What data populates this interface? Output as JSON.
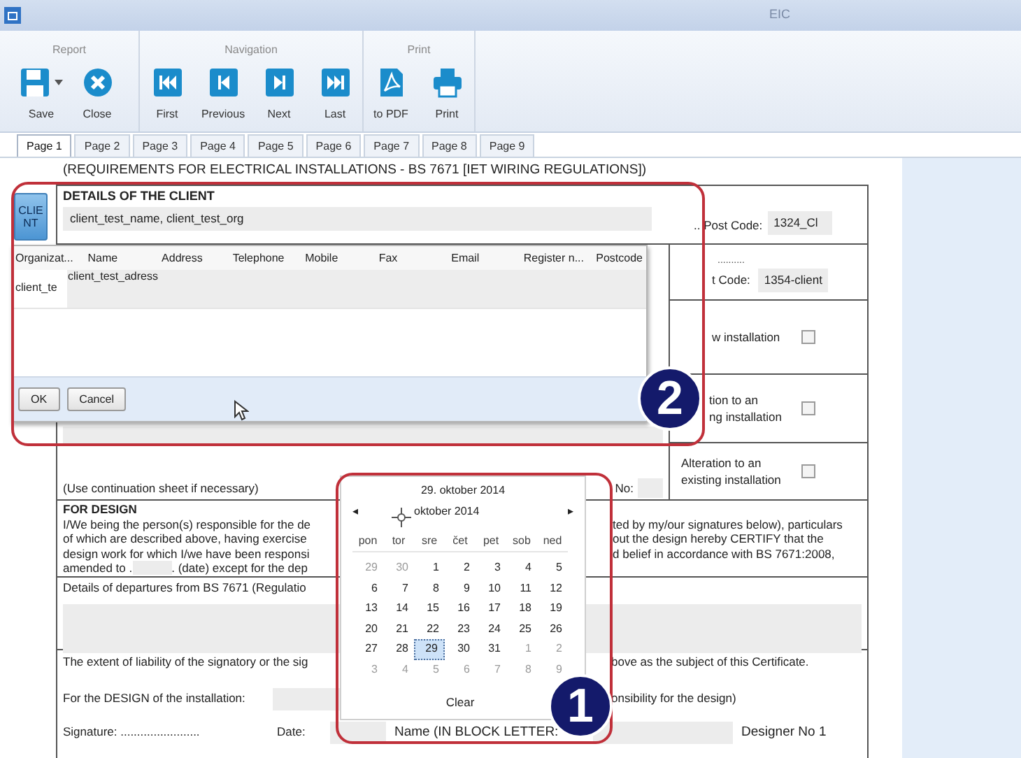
{
  "window": {
    "title": "EIC"
  },
  "ribbon": {
    "groups": [
      {
        "label": "Report",
        "buttons": [
          {
            "label": "Save",
            "kind": "save",
            "dropdown": true
          },
          {
            "label": "Close",
            "kind": "close",
            "dropdown": false
          }
        ]
      },
      {
        "label": "Navigation",
        "buttons": [
          {
            "label": "First",
            "kind": "first",
            "dropdown": false
          },
          {
            "label": "Previous",
            "kind": "previous",
            "dropdown": false
          },
          {
            "label": "Next",
            "kind": "next",
            "dropdown": false
          },
          {
            "label": "Last",
            "kind": "last",
            "dropdown": false
          }
        ]
      },
      {
        "label": "Print",
        "buttons": [
          {
            "label": "to PDF",
            "kind": "pdf",
            "dropdown": false
          },
          {
            "label": "Print",
            "kind": "print",
            "dropdown": false
          }
        ]
      }
    ]
  },
  "tabs": [
    {
      "label": "Page 1",
      "selected": true
    },
    {
      "label": "Page 2",
      "selected": false
    },
    {
      "label": "Page 3",
      "selected": false
    },
    {
      "label": "Page 4",
      "selected": false
    },
    {
      "label": "Page 5",
      "selected": false
    },
    {
      "label": "Page 6",
      "selected": false
    },
    {
      "label": "Page 7",
      "selected": false
    },
    {
      "label": "Page 8",
      "selected": false
    },
    {
      "label": "Page 9",
      "selected": false
    }
  ],
  "document": {
    "heading": "(REQUIREMENTS FOR ELECTRICAL INSTALLATIONS - BS 7671 [IET WIRING REGULATIONS])",
    "client_button": "CLIENT",
    "client_title": "DETAILS OF THE CLIENT",
    "client_value": "client_test_name, client_test_org",
    "post_code_label": ".. Post Code:",
    "post_code_value": "1324_Cl",
    "installation_dots": "..........",
    "installation_post_code_label": "t Code:",
    "installation_post_code_value": "1354-client",
    "options": [
      {
        "lines": [
          "w installation"
        ],
        "checked": false
      },
      {
        "lines": [
          "tion to an",
          "ng installation"
        ],
        "checked": false
      },
      {
        "lines": [
          "Alteration to an",
          "existing installation"
        ],
        "checked": false
      }
    ],
    "continuation_note": "(Use continuation sheet if necessary)",
    "no_label": "No:",
    "design_title": "FOR DESIGN",
    "design_left_lines": [
      "I/We being the person(s) responsible for the de",
      "of which are described above, having exercise",
      "design work for which I/we have been responsi"
    ],
    "amended_prefix": "amended to .",
    "amended_suffix": ". (date) except for the dep",
    "design_right_lines": [
      "ted by my/our signatures below), particulars",
      "out the design hereby CERTIFY that the",
      "d belief in accordance with BS 7671:2008,"
    ],
    "departures_label": "Details of departures from BS 7671 (Regulatio",
    "liability_left": "The extent of liability of the signatory or the sig",
    "liability_right": "bove as the subject of this Certificate.",
    "design_installation_label": "For the DESIGN of the installation:",
    "responsibility_right": "onsibility for the design)",
    "signature_label": "Signature: ........................",
    "date_label": "Date:",
    "name_label": "Name (IN BLOCK LETTER:",
    "designer_label": "Designer No 1"
  },
  "client_dialog": {
    "columns": [
      "Organizat...",
      "Name",
      "Address",
      "Telephone",
      "Mobile",
      "Fax",
      "Email",
      "Register n...",
      "Postcode"
    ],
    "row_first_cell": "client_te",
    "editor_value": "client_test_adress",
    "buttons": [
      "OK",
      "Cancel"
    ]
  },
  "date_picker": {
    "selected_date": "29. oktober 2014",
    "month": "oktober 2014",
    "prev": "◂",
    "next": "▸",
    "weekdays": [
      "pon",
      "tor",
      "sre",
      "čet",
      "pet",
      "sob",
      "ned"
    ],
    "weeks": [
      [
        {
          "day": "29",
          "muted": true,
          "selected": false
        },
        {
          "day": "30",
          "muted": true,
          "selected": false
        },
        {
          "day": "1",
          "muted": false,
          "selected": false
        },
        {
          "day": "2",
          "muted": false,
          "selected": false
        },
        {
          "day": "3",
          "muted": false,
          "selected": false
        },
        {
          "day": "4",
          "muted": false,
          "selected": false
        },
        {
          "day": "5",
          "muted": false,
          "selected": false
        }
      ],
      [
        {
          "day": "6",
          "muted": false,
          "selected": false
        },
        {
          "day": "7",
          "muted": false,
          "selected": false
        },
        {
          "day": "8",
          "muted": false,
          "selected": false
        },
        {
          "day": "9",
          "muted": false,
          "selected": false
        },
        {
          "day": "10",
          "muted": false,
          "selected": false
        },
        {
          "day": "11",
          "muted": false,
          "selected": false
        },
        {
          "day": "12",
          "muted": false,
          "selected": false
        }
      ],
      [
        {
          "day": "13",
          "muted": false,
          "selected": false
        },
        {
          "day": "14",
          "muted": false,
          "selected": false
        },
        {
          "day": "15",
          "muted": false,
          "selected": false
        },
        {
          "day": "16",
          "muted": false,
          "selected": false
        },
        {
          "day": "17",
          "muted": false,
          "selected": false
        },
        {
          "day": "18",
          "muted": false,
          "selected": false
        },
        {
          "day": "19",
          "muted": false,
          "selected": false
        }
      ],
      [
        {
          "day": "20",
          "muted": false,
          "selected": false
        },
        {
          "day": "21",
          "muted": false,
          "selected": false
        },
        {
          "day": "22",
          "muted": false,
          "selected": false
        },
        {
          "day": "23",
          "muted": false,
          "selected": false
        },
        {
          "day": "24",
          "muted": false,
          "selected": false
        },
        {
          "day": "25",
          "muted": false,
          "selected": false
        },
        {
          "day": "26",
          "muted": false,
          "selected": false
        }
      ],
      [
        {
          "day": "27",
          "muted": false,
          "selected": false
        },
        {
          "day": "28",
          "muted": false,
          "selected": false
        },
        {
          "day": "29",
          "muted": false,
          "selected": true
        },
        {
          "day": "30",
          "muted": false,
          "selected": false
        },
        {
          "day": "31",
          "muted": false,
          "selected": false
        },
        {
          "day": "1",
          "muted": true,
          "selected": false
        },
        {
          "day": "2",
          "muted": true,
          "selected": false
        }
      ],
      [
        {
          "day": "3",
          "muted": true,
          "selected": false
        },
        {
          "day": "4",
          "muted": true,
          "selected": false
        },
        {
          "day": "5",
          "muted": true,
          "selected": false
        },
        {
          "day": "6",
          "muted": true,
          "selected": false
        },
        {
          "day": "7",
          "muted": true,
          "selected": false
        },
        {
          "day": "8",
          "muted": true,
          "selected": false
        },
        {
          "day": "9",
          "muted": true,
          "selected": false
        }
      ]
    ],
    "clear": "Clear"
  },
  "annotations": [
    {
      "number": "1"
    },
    {
      "number": "2"
    }
  ]
}
